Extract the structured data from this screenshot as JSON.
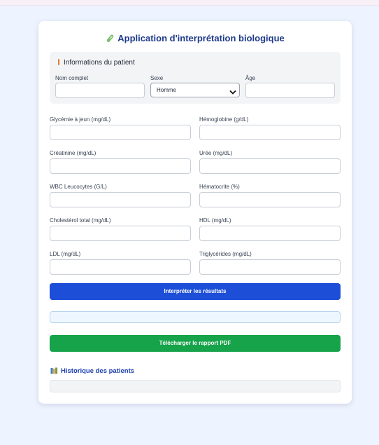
{
  "app": {
    "title": "Application d'interprétation biologique"
  },
  "patient": {
    "section_title": "Informations du patient",
    "name_label": "Nom complet",
    "name_value": "",
    "sex_label": "Sexe",
    "sex_value": "Homme",
    "age_label": "Âge",
    "age_value": ""
  },
  "fields": [
    {
      "label": "Glycémie à jeun (mg/dL)",
      "value": ""
    },
    {
      "label": "Hémoglobine (g/dL)",
      "value": ""
    },
    {
      "label": "Créatinine (mg/dL)",
      "value": ""
    },
    {
      "label": "Urée (mg/dL)",
      "value": ""
    },
    {
      "label": "WBC Leucocytes (G/L)",
      "value": ""
    },
    {
      "label": "Hématocrite (%)",
      "value": ""
    },
    {
      "label": "Cholestérol total (mg/dL)",
      "value": ""
    },
    {
      "label": "HDL (mg/dL)",
      "value": ""
    },
    {
      "label": "LDL (mg/dL)",
      "value": ""
    },
    {
      "label": "Triglycérides (mg/dL)",
      "value": ""
    }
  ],
  "actions": {
    "interpret_label": "Interpréter les résultats",
    "download_label": "Télécharger le rapport PDF"
  },
  "result": {
    "text": ""
  },
  "history": {
    "title": "Historique des patients",
    "content": ""
  },
  "colors": {
    "primary": "#1d4ed8",
    "success": "#16a34a",
    "heading": "#1e3a8a"
  }
}
